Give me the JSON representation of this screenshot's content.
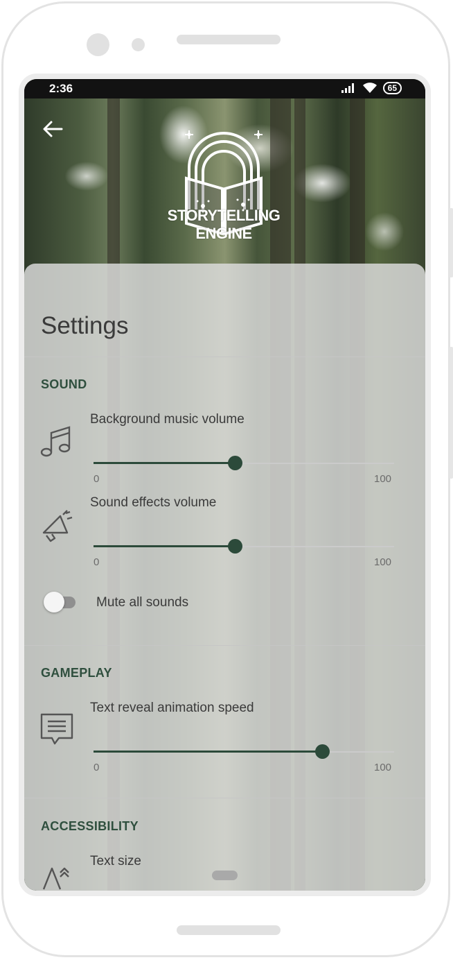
{
  "status_bar": {
    "time": "2:36",
    "battery": "65"
  },
  "header": {
    "logo_line1": "STORYTELLING",
    "logo_line2": "ENGINE"
  },
  "settings": {
    "title": "Settings",
    "sound": {
      "heading": "SOUND",
      "music_label": "Background music volume",
      "music_value": 47,
      "music_min": "0",
      "music_max": "100",
      "effects_label": "Sound effects volume",
      "effects_value": 47,
      "effects_min": "0",
      "effects_max": "100",
      "mute_label": "Mute all sounds",
      "mute_on": false
    },
    "gameplay": {
      "heading": "GAMEPLAY",
      "speed_label": "Text reveal animation speed",
      "speed_value": 76,
      "speed_min": "0",
      "speed_max": "100"
    },
    "accessibility": {
      "heading": "ACCESSIBILITY",
      "text_size_label": "Text size"
    }
  },
  "colors": {
    "accent": "#2c4a3a",
    "section_heading": "#2f4f3e"
  },
  "icons": [
    "back-arrow-icon",
    "music-note-icon",
    "megaphone-icon",
    "chat-text-icon",
    "text-size-icon"
  ]
}
